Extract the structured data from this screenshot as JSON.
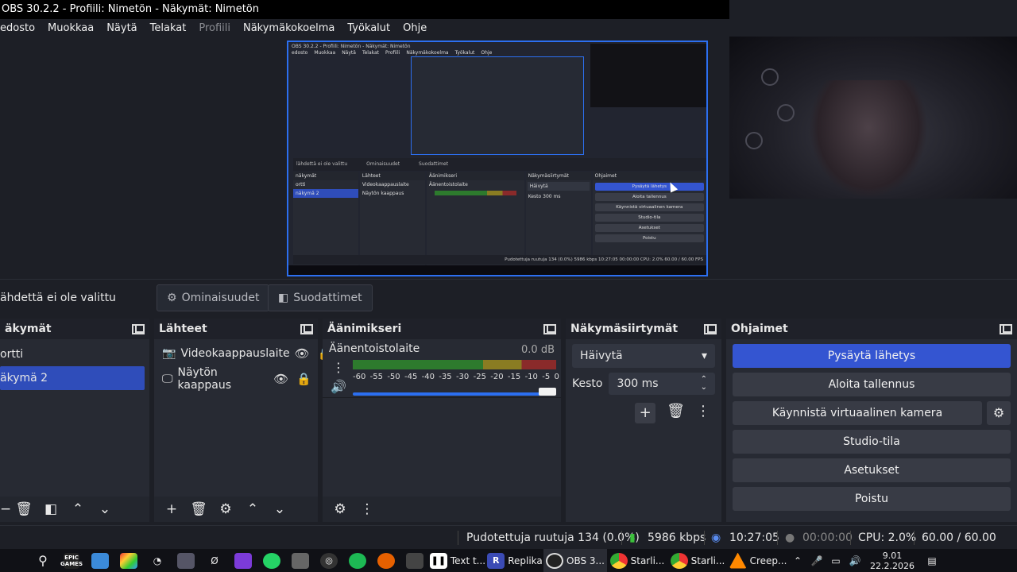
{
  "window": {
    "title": "OBS 30.2.2 - Profiili: Nimetön - Näkymät: Nimetön"
  },
  "menu": [
    "edosto",
    "Muokkaa",
    "Näytä",
    "Telakat",
    "Profiili",
    "Näkymäkokoelma",
    "Työkalut",
    "Ohje"
  ],
  "mini": {
    "title": "OBS 30.2.2 - Profiili: Nimetön - Näkymät: Nimetön",
    "menu": [
      "edosto",
      "Muokkaa",
      "Näytä",
      "Telakat",
      "Profiili",
      "Näkymäkokoelma",
      "Työkalut",
      "Ohje"
    ],
    "no_source": "lähdettä ei ole valittu",
    "properties": "Ominaisuudet",
    "filters": "Suodattimet",
    "scenes_header": "näkymät",
    "scene_items": [
      "ortti",
      "näkymä 2"
    ],
    "sources_header": "Lähteet",
    "source_items": [
      "Videokaappauslaite",
      "Näytön kaappaus"
    ],
    "mixer_header": "Äänimikseri",
    "mixer_device": "Äänentoistolaite",
    "transitions_header": "Näkymäsiirtymät",
    "transition": "Häivytä",
    "duration_label": "Kesto",
    "duration": "300 ms",
    "controls_header": "Ohjaimet",
    "controls": [
      "Pysäytä lähetys",
      "Aloita tallennus",
      "Käynnistä virtuaalinen kamera",
      "Studio-tila",
      "Asetukset",
      "Poistu"
    ],
    "status": "Pudotettuja ruutuja 134 (0.0%)   5986 kbps   10:27:05   00:00:00   CPU: 2.0%   60.00 / 60.00 FPS"
  },
  "source_toolbar": {
    "no_source": "ähdettä ei ole valittu",
    "properties": "Ominaisuudet",
    "filters": "Suodattimet"
  },
  "scenes": {
    "header": "äkymät",
    "items": [
      {
        "label": "ortti",
        "selected": false
      },
      {
        "label": "äkymä 2",
        "selected": true
      }
    ]
  },
  "sources": {
    "header": "Lähteet",
    "items": [
      {
        "label": "Videokaappauslaite",
        "icon": "camera-icon"
      },
      {
        "label": "Näytön kaappaus",
        "icon": "monitor-icon"
      }
    ]
  },
  "mixer": {
    "header": "Äänimikseri",
    "device": "Äänentoistolaite",
    "db": "0.0 dB",
    "scale": [
      "-60",
      "-55",
      "-50",
      "-45",
      "-40",
      "-35",
      "-30",
      "-25",
      "-20",
      "-15",
      "-10",
      "-5",
      "0"
    ],
    "volume": 1.0
  },
  "transitions": {
    "header": "Näkymäsiirtymät",
    "selected": "Häivytä",
    "duration_label": "Kesto",
    "duration": "300 ms"
  },
  "controls": {
    "header": "Ohjaimet",
    "stop_stream": "Pysäytä lähetys",
    "start_record": "Aloita tallennus",
    "virtual_cam": "Käynnistä virtuaalinen kamera",
    "studio_mode": "Studio-tila",
    "settings": "Asetukset",
    "exit": "Poistu"
  },
  "status": {
    "dropped": "Pudotettuja ruutuja 134 (0.0%)",
    "bitrate": "5986 kbps",
    "stream_time": "10:27:05",
    "record_time": "00:00:00",
    "cpu": "CPU: 2.0%",
    "fps": "60.00 / 60.00 FPS"
  },
  "taskbar": {
    "epic": "EPIC GAMES",
    "apps": [
      {
        "label": "Text t...",
        "icon": "text-icon"
      },
      {
        "label": "Replika",
        "icon": "replika-icon"
      },
      {
        "label": "OBS 3...",
        "icon": "obs-icon"
      },
      {
        "label": "Starli...",
        "icon": "chrome-icon"
      },
      {
        "label": "Starli...",
        "icon": "chrome-icon"
      },
      {
        "label": "Creep...",
        "icon": "vlc-icon"
      }
    ],
    "time": "9.01",
    "date": "22.2.2026"
  },
  "colors": {
    "accent": "#3455d1",
    "preview_border": "#2c6ff0",
    "bg": "#1d1f26",
    "dock": "#272a33"
  }
}
